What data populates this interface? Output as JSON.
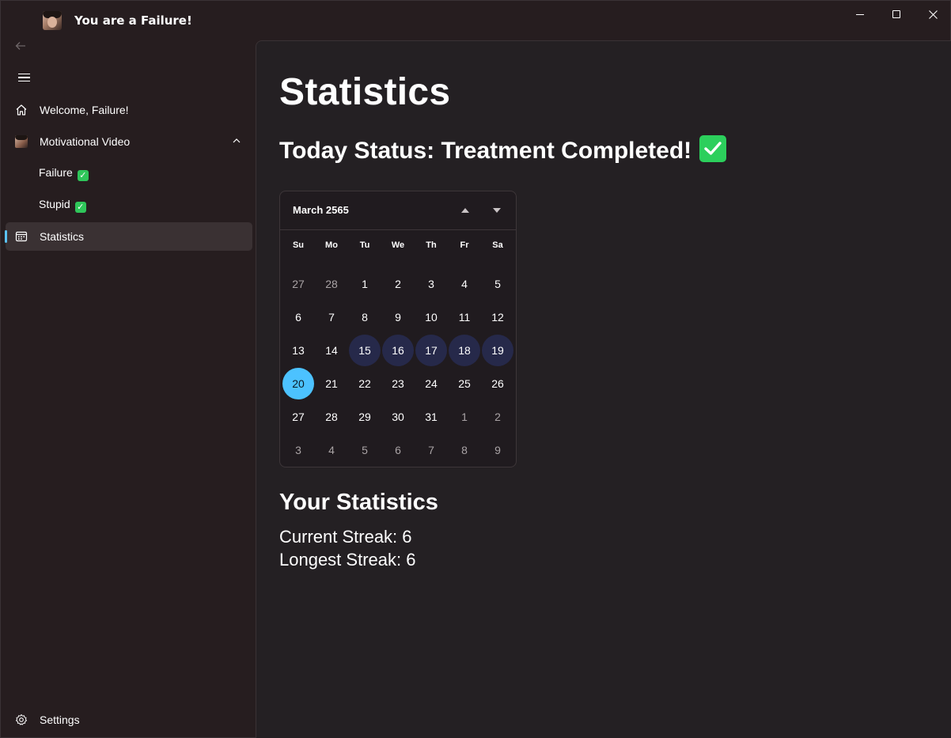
{
  "window": {
    "title": "You are a Failure!"
  },
  "sidebar": {
    "items": [
      {
        "label": "Welcome, Failure!",
        "icon": "home-icon"
      },
      {
        "label": "Motivational Video",
        "icon": "avatar"
      },
      {
        "label": "Failure",
        "icon": "check-icon"
      },
      {
        "label": "Stupid",
        "icon": "check-icon"
      },
      {
        "label": "Statistics",
        "icon": "calendar-icon"
      }
    ],
    "footer": {
      "label": "Settings",
      "icon": "gear-icon"
    }
  },
  "main": {
    "title": "Statistics",
    "status": "Today Status: Treatment Completed!",
    "calendar": {
      "month": "March 2565",
      "weekdays": [
        "Su",
        "Mo",
        "Tu",
        "We",
        "Th",
        "Fr",
        "Sa"
      ],
      "days": [
        {
          "d": "27",
          "state": "out"
        },
        {
          "d": "28",
          "state": "out"
        },
        {
          "d": "1"
        },
        {
          "d": "2"
        },
        {
          "d": "3"
        },
        {
          "d": "4"
        },
        {
          "d": "5"
        },
        {
          "d": "6"
        },
        {
          "d": "7"
        },
        {
          "d": "8"
        },
        {
          "d": "9"
        },
        {
          "d": "10"
        },
        {
          "d": "11"
        },
        {
          "d": "12"
        },
        {
          "d": "13"
        },
        {
          "d": "14"
        },
        {
          "d": "15",
          "state": "done"
        },
        {
          "d": "16",
          "state": "done"
        },
        {
          "d": "17",
          "state": "done"
        },
        {
          "d": "18",
          "state": "done"
        },
        {
          "d": "19",
          "state": "done"
        },
        {
          "d": "20",
          "state": "today"
        },
        {
          "d": "21"
        },
        {
          "d": "22"
        },
        {
          "d": "23"
        },
        {
          "d": "24"
        },
        {
          "d": "25"
        },
        {
          "d": "26"
        },
        {
          "d": "27"
        },
        {
          "d": "28"
        },
        {
          "d": "29"
        },
        {
          "d": "30"
        },
        {
          "d": "31"
        },
        {
          "d": "1",
          "state": "out"
        },
        {
          "d": "2",
          "state": "out"
        },
        {
          "d": "3",
          "state": "out"
        },
        {
          "d": "4",
          "state": "out"
        },
        {
          "d": "5",
          "state": "out"
        },
        {
          "d": "6",
          "state": "out"
        },
        {
          "d": "7",
          "state": "out"
        },
        {
          "d": "8",
          "state": "out"
        },
        {
          "d": "9",
          "state": "out"
        }
      ]
    },
    "stats_title": "Your Statistics",
    "current_streak": "Current Streak: 6",
    "longest_streak": "Longest Streak: 6"
  },
  "colors": {
    "accent": "#4cc2ff",
    "selection_indicator": "#5bc3f5",
    "completed_day": "#26294a",
    "check_green": "#2ccf5c"
  }
}
